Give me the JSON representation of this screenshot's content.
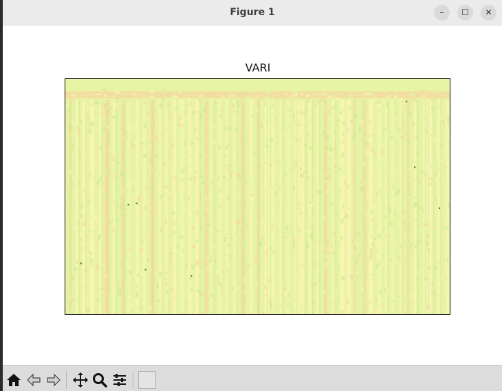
{
  "window": {
    "title": "Figure 1",
    "controls": {
      "minimize": "–",
      "maximize": "☐",
      "close": "✕"
    }
  },
  "figure": {
    "title": "VARI",
    "colormap": [
      "#f3d9a0",
      "#fbf3b5",
      "#e5f4a4",
      "#cde88f"
    ]
  },
  "toolbar": {
    "buttons": [
      "home-icon",
      "back-icon",
      "forward-icon",
      "pan-icon",
      "zoom-icon",
      "configure-subplots-icon"
    ],
    "coordinates": ""
  }
}
